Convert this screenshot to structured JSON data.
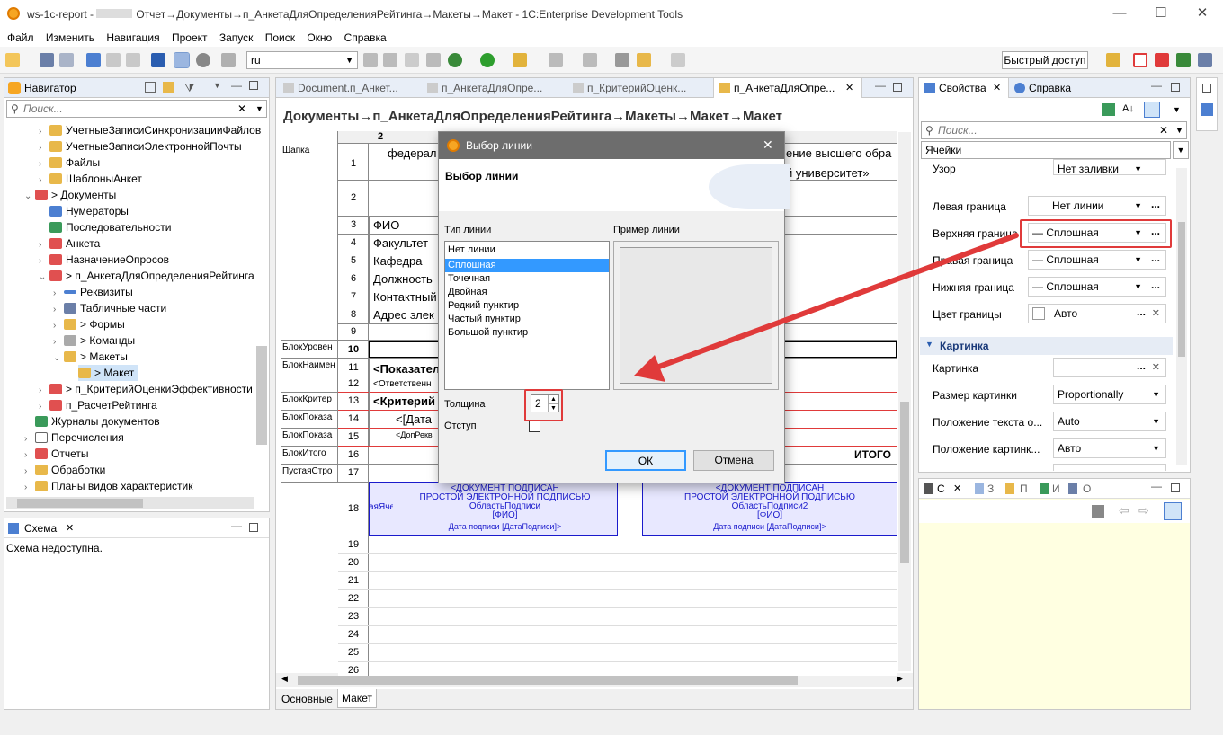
{
  "window": {
    "title_prefix": "ws-1c-report - ",
    "title": "Отчет→Документы→п_АнкетаДляОпределенияРейтинга→Макеты→Макет - 1C:Enterprise Development Tools",
    "minimize": "—",
    "maximize": "☐",
    "close": "✕"
  },
  "menu": [
    "Файл",
    "Изменить",
    "Навигация",
    "Проект",
    "Запуск",
    "Поиск",
    "Окно",
    "Справка"
  ],
  "toolbar": {
    "combo_value": "ru",
    "quick_access": "Быстрый доступ"
  },
  "navigator": {
    "tab": "Навигатор",
    "search_placeholder": "Поиск...",
    "items": [
      "УчетныеЗаписиСинхронизацииФайлов",
      "УчетныеЗаписиЭлектроннойПочты",
      "Файлы",
      "ШаблоныАнкет",
      "> Документы",
      "Нумераторы",
      "Последовательности",
      "Анкета",
      "НазначениеОпросов",
      "> п_АнкетаДляОпределенияРейтинга",
      "Реквизиты",
      "Табличные части",
      "> Формы",
      "> Команды",
      "> Макеты",
      "> Макет",
      "> п_КритерийОценкиЭффективности",
      "п_РасчетРейтинга",
      "Журналы документов",
      "Перечисления",
      "Отчеты",
      "Обработки",
      "Планы видов характеристик"
    ]
  },
  "schema": {
    "tab": "Схема",
    "message": "Схема недоступна."
  },
  "editor": {
    "tabs": [
      "Document.п_Анкет...",
      "п_АнкетаДляОпре...",
      "п_КритерийОценк...",
      "п_АнкетаДляОпре..."
    ],
    "breadcrumb": "Документы→п_АнкетаДляОпределенияРейтинга→Макеты→Макет→Макет",
    "col_header": "2",
    "sections": [
      "Шапка",
      "БлокУровен",
      "БлокНаимен",
      "БлокКритер",
      "БлокПоказа",
      "БлокПоказа",
      "БлокИтого",
      "ПустаяСтро"
    ],
    "cells": {
      "r1": "федерал",
      "r1b": "ение высшего обра",
      "r1c": "й университет»",
      "r3": "ФИО",
      "r4": "Факультет",
      "r5": "Кафедра",
      "r6": "Должность",
      "r7": "Контактный",
      "r8": "Адрес элек",
      "r11": "<Показател",
      "r12": "<Ответственн",
      "r13": "<Критерий",
      "r14": "<[Дата",
      "r15": "<ДопРекв",
      "r16": "ИТОГО",
      "r18a": "аяЯчейка"
    },
    "sign1": [
      "<ДОКУМЕНТ ПОДПИСАН",
      "ПРОСТОЙ ЭЛЕКТРОННОЙ ПОДПИСЬЮ",
      "ОбластьПодписи",
      "[ФИО]",
      "Дата подписи [ДатаПодписи]>"
    ],
    "sign2": [
      "<ДОКУМЕНТ ПОДПИСАН",
      "ПРОСТОЙ ЭЛЕКТРОННОЙ ПОДПИСЬЮ",
      "ОбластьПодписи2",
      "[ФИО]",
      "Дата подписи [ДатаПодписи]>"
    ],
    "bottom_tabs": [
      "Основные",
      "Макет"
    ]
  },
  "dialog": {
    "title": "Выбор линии",
    "heading": "Выбор линии",
    "type_label": "Тип линии",
    "sample_label": "Пример линии",
    "line_types": [
      "Нет линии",
      "Сплошная",
      "Точечная",
      "Двойная",
      "Редкий пунктир",
      "Частый пунктир",
      "Большой пунктир"
    ],
    "selected": "Сплошная",
    "thickness_label": "Толщина",
    "thickness_value": "2",
    "indent_label": "Отступ",
    "ok": "ОК",
    "cancel": "Отмена"
  },
  "properties": {
    "tabs": [
      "Свойства",
      "Справка"
    ],
    "search_placeholder": "Поиск...",
    "scope": "Ячейки",
    "rows": [
      {
        "label": "Узор",
        "value": "Нет заливки"
      },
      {
        "label": "Левая граница",
        "value": "Нет линии"
      },
      {
        "label": "Верхняя граница",
        "value": "— Сплошная"
      },
      {
        "label": "Правая граница",
        "value": "— Сплошная"
      },
      {
        "label": "Нижняя граница",
        "value": "— Сплошная"
      },
      {
        "label": "Цвет границы",
        "value": "Авто"
      }
    ],
    "section2": "Картинка",
    "rows2": [
      {
        "label": "Картинка",
        "value": ""
      },
      {
        "label": "Размер картинки",
        "value": "Proportionally"
      },
      {
        "label": "Положение текста о...",
        "value": "Auto"
      },
      {
        "label": "Положение картинк...",
        "value": "Авто"
      }
    ]
  },
  "lower_right": {
    "tabs": [
      "С",
      "З",
      "П",
      "И",
      "О"
    ]
  },
  "colors": {
    "accent": "#3399ff",
    "red": "#e03a3a",
    "selection": "#3399ff",
    "yellow": "#ffffe1",
    "sign_bg": "#e8e8ff",
    "sign_border": "#1a1acc"
  }
}
